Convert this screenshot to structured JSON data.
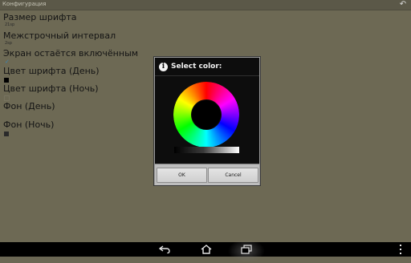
{
  "app": {
    "title": "Конфигурация",
    "back_icon": "undo-arrow-icon"
  },
  "preferences": [
    {
      "label": "Размер шрифта",
      "value": "21sp"
    },
    {
      "label": "Межстрочный интервал",
      "value": "2sp"
    },
    {
      "label": "Экран остаётся включённым",
      "checked": true
    },
    {
      "label": "Цвет шрифта (День)",
      "color": "#000000"
    },
    {
      "label": "Цвет шрифта (Ночь)",
      "color": "#6d6954"
    },
    {
      "label": "Фон (День)",
      "color": "#6d6954"
    },
    {
      "label": "Фон (Ночь)",
      "color": "#2a2a2a"
    }
  ],
  "dialog": {
    "title": "Select color:",
    "icon": "info-icon",
    "ok_label": "OK",
    "cancel_label": "Cancel"
  },
  "navbar": {
    "back_icon": "back-icon",
    "home_icon": "home-icon",
    "recents_icon": "recents-icon",
    "menu_icon": "overflow-menu-icon"
  },
  "colors": {
    "background": "#6d6954",
    "dialog_background": "#0d0d0d",
    "accent_check": "#3a86b8"
  }
}
